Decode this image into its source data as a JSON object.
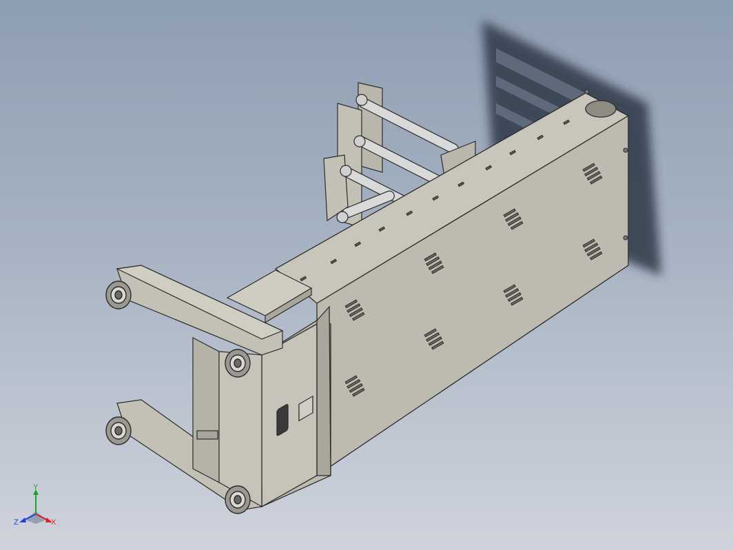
{
  "viewport": {
    "background_top": "#8e9eb2",
    "background_bottom": "#cfd3dc"
  },
  "model": {
    "body_color": "#c3c1b6",
    "body_side_color": "#a8a69b",
    "edge_color": "#2b2b2b",
    "shadow_color": "#2f3946",
    "rod_color": "#d9d9d9"
  },
  "triad": {
    "x_label": "X",
    "y_label": "Y",
    "z_label": "Z",
    "x_color": "#e02020",
    "y_color": "#1fa02a",
    "z_color": "#2040e0"
  }
}
